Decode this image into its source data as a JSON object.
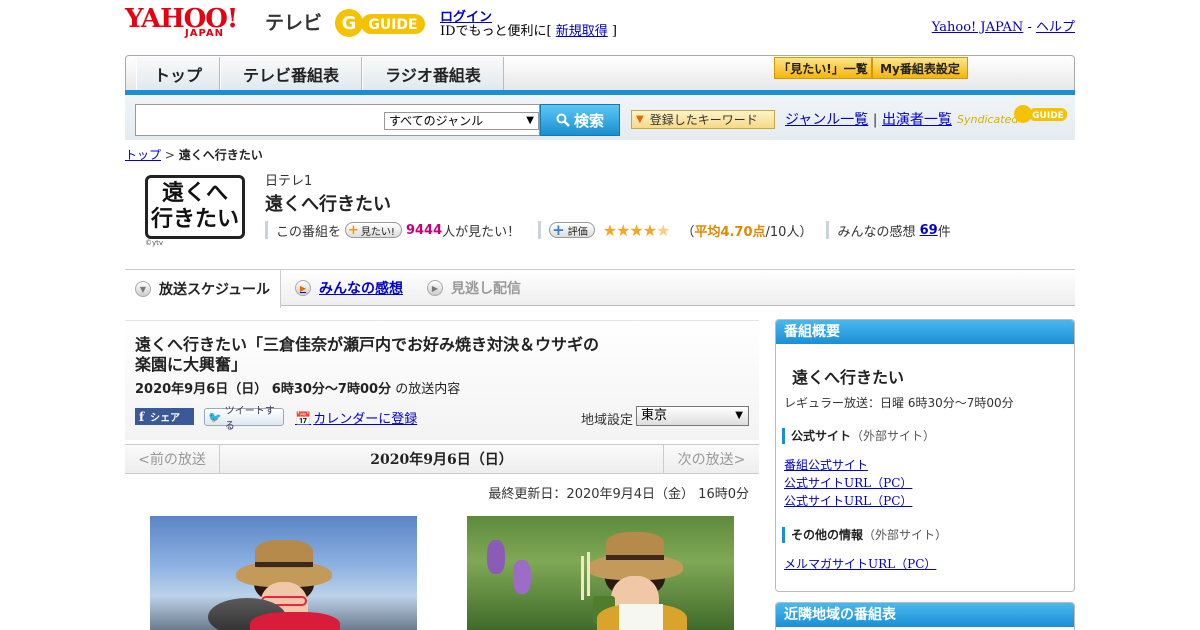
{
  "header": {
    "yahoo_logo": "YAHOO!",
    "yahoo_japan": "JAPAN",
    "tv_label": "テレビ",
    "gguide_logo": "G-GUIDE",
    "login_link": "ログイン",
    "login_sub_prefix": "IDでもっと便利に[ ",
    "signup_link": "新規取得",
    "login_sub_suffix": " ]",
    "yahoo_japan_link": "Yahoo! JAPAN",
    "link_sep": " - ",
    "help_link": "ヘルプ"
  },
  "nav": {
    "tabs": [
      {
        "label": "トップ"
      },
      {
        "label": "テレビ番組表"
      },
      {
        "label": "ラジオ番組表"
      }
    ],
    "mitai_list": "「見たい!」一覧",
    "my_settings": "My番組表設定"
  },
  "search": {
    "input_value": "",
    "genre": "すべてのジャンル",
    "button": "検索",
    "keyword_button": "登録したキーワード",
    "genre_list_link": "ジャンル一覧",
    "divider": " | ",
    "performer_list_link": "出演者一覧",
    "syndicated": "Syndicated"
  },
  "breadcrumb": {
    "home": "トップ",
    "separator": " > ",
    "current": "遠くへ行きたい"
  },
  "program": {
    "logo_line1": "遠くへ",
    "logo_line2": "行きたい",
    "logo_copy": "©ytv",
    "channel": "日テレ1",
    "title": "遠くへ行きたい",
    "watch_prefix": "この番組を",
    "watch_button": "見たい!",
    "watch_count": "9444",
    "watch_suffix": "人が見たい！",
    "rate_button": "評価",
    "rating": 4.7,
    "avg_open": "（",
    "avg_rating": "平均4.70点",
    "avg_suffix": "/10人）",
    "comments_prefix": "みんなの感想",
    "comments_count": "69",
    "comments_suffix": "件"
  },
  "subtabs": [
    {
      "label": "放送スケジュール"
    },
    {
      "label": "みんなの感想"
    },
    {
      "label": "見逃し配信"
    }
  ],
  "episode": {
    "title": "遠くへ行きたい「三倉佳奈が瀬戸内でお好み焼き対決＆ウサギの楽園に大興奮」",
    "date_time": "2020年9月6日（日）  6時30分～7時00分",
    "date_suffix": "の放送内容",
    "share_fb": "シェア",
    "share_tw": "ツイートする",
    "calendar": "カレンダーに登録",
    "region_label": "地域設定",
    "region": "東京",
    "prev_day": "<前の放送",
    "cur_day": "2020年9月6日（日）",
    "next_day": "次の放送>",
    "last_updated": "最終更新日：2020年9月4日（金） 16時0分"
  },
  "sidebar": {
    "overview_head": "番組概要",
    "title": "遠くへ行きたい",
    "regular": "レギュラー放送：日曜 6時30分～7時00分",
    "official_head": "公式サイト",
    "official_note": "（外部サイト）",
    "links": [
      "番組公式サイト",
      "公式サイトURL（PC）",
      "公式サイトURL（PC）"
    ],
    "other_head": "その他の情報",
    "other_note": "（外部サイト）",
    "other_link": "メルマガサイトURL（PC）",
    "nearby_head": "近隣地域の番組表"
  },
  "colors": {
    "accent_blue": "#1b8fd6",
    "yahoo_red": "#e60012",
    "watch_pink": "#c8007a",
    "star": "#f5a623"
  }
}
